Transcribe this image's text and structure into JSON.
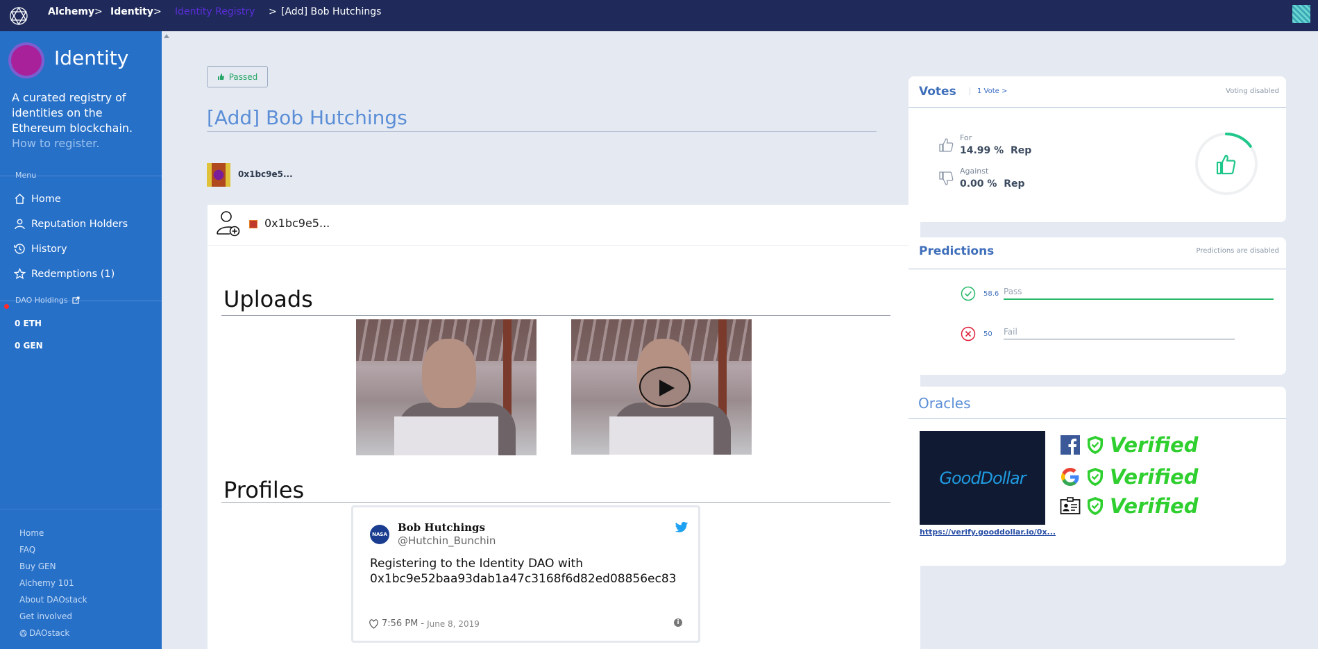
{
  "topbar": {
    "crumbs": [
      "Alchemy",
      "Identity",
      "Identity Registry",
      "[Add] Bob Hutchings"
    ],
    "separator": ">"
  },
  "sidebar": {
    "dao_name": "Identity",
    "description": "A curated registry of identities on the Ethereum blockchain.",
    "how_to_link": "How to register.",
    "menu_label": "Menu",
    "nav": [
      {
        "label": "Home",
        "icon": "home-icon"
      },
      {
        "label": "Reputation Holders",
        "icon": "user-icon"
      },
      {
        "label": "History",
        "icon": "history-icon"
      },
      {
        "label": "Redemptions (1)",
        "icon": "star-icon"
      }
    ],
    "holdings_label": "DAO Holdings",
    "holdings": [
      "0 ETH",
      "0 GEN"
    ],
    "footer_links": [
      "Home",
      "FAQ",
      "Buy GEN",
      "Alchemy 101",
      "About DAOstack",
      "Get involved",
      "DAOstack"
    ]
  },
  "proposal": {
    "status": "Passed",
    "title": "[Add] Bob Hutchings",
    "proposer": "0x1bc9e5...",
    "card_address": "0x1bc9e5...",
    "uploads_title": "Uploads",
    "profiles_title": "Profiles"
  },
  "tweet": {
    "avatar_text": "NASA",
    "name": "Bob Hutchings",
    "handle": "@Hutchin_Bunchin",
    "text": "Registering to the Identity DAO with 0x1bc9e52baa93dab1a47c3168f6d82ed08856ec83",
    "time": "7:56 PM",
    "dash": "-",
    "date": "June 8, 2019"
  },
  "votes": {
    "title": "Votes",
    "count_link": "1 Vote >",
    "note": "Voting disabled",
    "for_label": "For",
    "for_value": "14.99 %",
    "for_unit": "Rep",
    "against_label": "Against",
    "against_value": "0.00 %",
    "against_unit": "Rep",
    "gauge_fraction": 0.1499,
    "accent": "#1fc78a"
  },
  "predictions": {
    "title": "Predictions",
    "note": "Predictions are disabled",
    "pass_value": "58.6",
    "pass_label": "Pass",
    "fail_value": "50",
    "fail_label": "Fail",
    "pass_color": "#27b96a",
    "fail_color": "#e0203a"
  },
  "oracles": {
    "title": "Oracles",
    "brand": "GoodDollar",
    "link": "https://verify.gooddollar.io/0x...",
    "verified": [
      {
        "provider": "facebook-icon",
        "text": "Verified"
      },
      {
        "provider": "google-icon",
        "text": "Verified"
      },
      {
        "provider": "id-card-icon",
        "text": "Verified"
      }
    ]
  }
}
